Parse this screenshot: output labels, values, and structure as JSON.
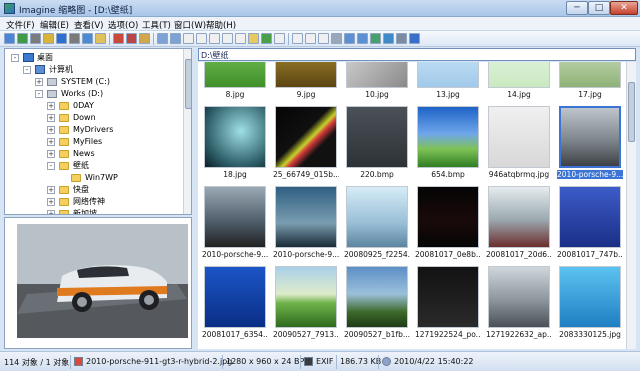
{
  "window": {
    "title": "Imagine 缩略图 - [D:\\壁纸]",
    "min_label": "─",
    "max_label": "□",
    "close_label": "✕"
  },
  "menu": [
    "文件(F)",
    "编辑(E)",
    "查看(V)",
    "选项(O)",
    "工具(T)",
    "窗口(W)",
    "帮助(H)"
  ],
  "address": {
    "value": "D:\\壁纸"
  },
  "tree": [
    {
      "label": "桌面",
      "icon": "desktop-icon",
      "level": 0,
      "expander": "-"
    },
    {
      "label": "计算机",
      "icon": "computer-icon",
      "level": 1,
      "expander": "-"
    },
    {
      "label": "SYSTEM (C:)",
      "icon": "drive-icon",
      "level": 2,
      "expander": "+"
    },
    {
      "label": "Works (D:)",
      "icon": "drive-icon",
      "level": 2,
      "expander": "-"
    },
    {
      "label": "0DAY",
      "icon": "folder-icon",
      "level": 3,
      "expander": "+"
    },
    {
      "label": "Down",
      "icon": "folder-icon",
      "level": 3,
      "expander": "+"
    },
    {
      "label": "MyDrivers",
      "icon": "folder-icon",
      "level": 3,
      "expander": "+"
    },
    {
      "label": "MyFiles",
      "icon": "folder-icon",
      "level": 3,
      "expander": "+"
    },
    {
      "label": "News",
      "icon": "folder-icon",
      "level": 3,
      "expander": "+"
    },
    {
      "label": "壁纸",
      "icon": "folder-icon",
      "level": 3,
      "expander": "-"
    },
    {
      "label": "Win7WP",
      "icon": "folder-icon",
      "level": 4,
      "expander": ""
    },
    {
      "label": "快盘",
      "icon": "folder-icon",
      "level": 3,
      "expander": "+"
    },
    {
      "label": "网络传神",
      "icon": "folder-icon",
      "level": 3,
      "expander": "+"
    },
    {
      "label": "新加坡",
      "icon": "folder-icon",
      "level": 3,
      "expander": "+"
    }
  ],
  "thumbnails": [
    {
      "name": "8.jpg",
      "bg": "linear-gradient(180deg,#8fd86a,#3f8f2a)"
    },
    {
      "name": "9.jpg",
      "bg": "linear-gradient(180deg,#caa83a,#5b4513)"
    },
    {
      "name": "10.jpg",
      "bg": "linear-gradient(135deg,#e2e2e2,#8a8a8a)"
    },
    {
      "name": "13.jpg",
      "bg": "linear-gradient(180deg,#dff3ff,#a0c9ea)"
    },
    {
      "name": "14.jpg",
      "bg": "linear-gradient(180deg,#f3f9f3,#c9e9c0)"
    },
    {
      "name": "17.jpg",
      "bg": "linear-gradient(180deg,#e4f0dc,#8fb277)"
    },
    {
      "name": "18.jpg",
      "bg": "radial-gradient(circle at 60% 40%,#9fe0e4,#2a5a64 70%,#0c1d25)"
    },
    {
      "name": "25_66749_015b...",
      "bg": "linear-gradient(135deg,#050505,#101010 45%,#c9d12b 55%,#d43b3b 60%,#111 70%)"
    },
    {
      "name": "220.bmp",
      "bg": "linear-gradient(180deg,#4a5157,#2d3236)"
    },
    {
      "name": "654.bmp",
      "bg": "linear-gradient(180deg,#1f63c8 0%,#6fa7ea 45%,#7fc256 70%,#2f7e24 100%)"
    },
    {
      "name": "946atqbrmq.jpg",
      "bg": "linear-gradient(180deg,#f0f0f0,#d8d8d8)"
    },
    {
      "name": "2010-porsche-9...",
      "bg": "linear-gradient(180deg,#bfc5cc,#7e868d 55%,#3d4146)"
    },
    {
      "name": "2010-porsche-9...",
      "bg": "linear-gradient(180deg,#9aa9b4,#4b5a66 60%,#222)"
    },
    {
      "name": "2010-porsche-9...",
      "bg": "linear-gradient(180deg,#2f5f82,#7a9db0 60%,#1a2b37)"
    },
    {
      "name": "20080925_f2254...",
      "bg": "linear-gradient(180deg,#d6ecf7,#98bfd6 60%,#5d84a0)"
    },
    {
      "name": "20081017_0e8b...",
      "bg": "linear-gradient(180deg,#050505,#1a0a0a 55%,#050505)"
    },
    {
      "name": "20081017_20d6...",
      "bg": "linear-gradient(180deg,#e6ecef,#9aa8ae 55%,#6c2d2d)"
    },
    {
      "name": "20081017_747b...",
      "bg": "linear-gradient(180deg,#3d5cc9,#1a2f86)"
    },
    {
      "name": "20081017_6354...",
      "bg": "linear-gradient(180deg,#1b55c7,#0a2e86)"
    },
    {
      "name": "20090527_7913...",
      "bg": "linear-gradient(180deg,#a9cfe8 0%,#dfeccb 45%,#6fb24a 60%,#2e6a1d 100%)"
    },
    {
      "name": "20090527_b1fb...",
      "bg": "linear-gradient(180deg,#5d8fc7,#9bc0da 45%,#3d6a2a 75%,#1e3a16)"
    },
    {
      "name": "1271922524_po...",
      "bg": "linear-gradient(180deg,#121212,#2a2a2a)"
    },
    {
      "name": "1271922632_ap...",
      "bg": "linear-gradient(180deg,#cfd6dc,#8d969d 55%,#4a5056)"
    },
    {
      "name": "2083330125.jpg",
      "bg": "linear-gradient(180deg,#5cc2f0,#1f7fc4)"
    }
  ],
  "selected_index": 11,
  "status": {
    "count": "114 对象 / 1 对象",
    "filename": "2010-porsche-911-gt3-r-hybrid-2.jpg",
    "dimensions": "1280 x 960 x 24 BPP",
    "exif": "EXIF",
    "size": "186.73 KB",
    "date": "2010/4/22 15:40:22"
  },
  "colors": {
    "accent": "#3b74d5",
    "title_bar": "#b9d1ee"
  },
  "icons": {
    "toolbar": [
      "open-icon",
      "save-icon",
      "print-icon",
      "copy-icon",
      "info-icon",
      "settings-icon",
      "scan-icon",
      "new-folder-icon",
      "delete-icon",
      "cut-icon",
      "paste-icon",
      "undo-icon",
      "redo-icon",
      "thumb-view-icon",
      "thumb-view2-icon",
      "slideshow-icon",
      "rotate-icon",
      "filter-icon",
      "up-folder-icon",
      "refresh-icon",
      "details-view-icon",
      "list-view-icon",
      "icons-view-icon",
      "tiles-view-icon",
      "tools-icon",
      "zoom-in-icon",
      "zoom-out-icon",
      "fit-icon",
      "compare-icon",
      "edit-icon",
      "help-icon"
    ]
  }
}
